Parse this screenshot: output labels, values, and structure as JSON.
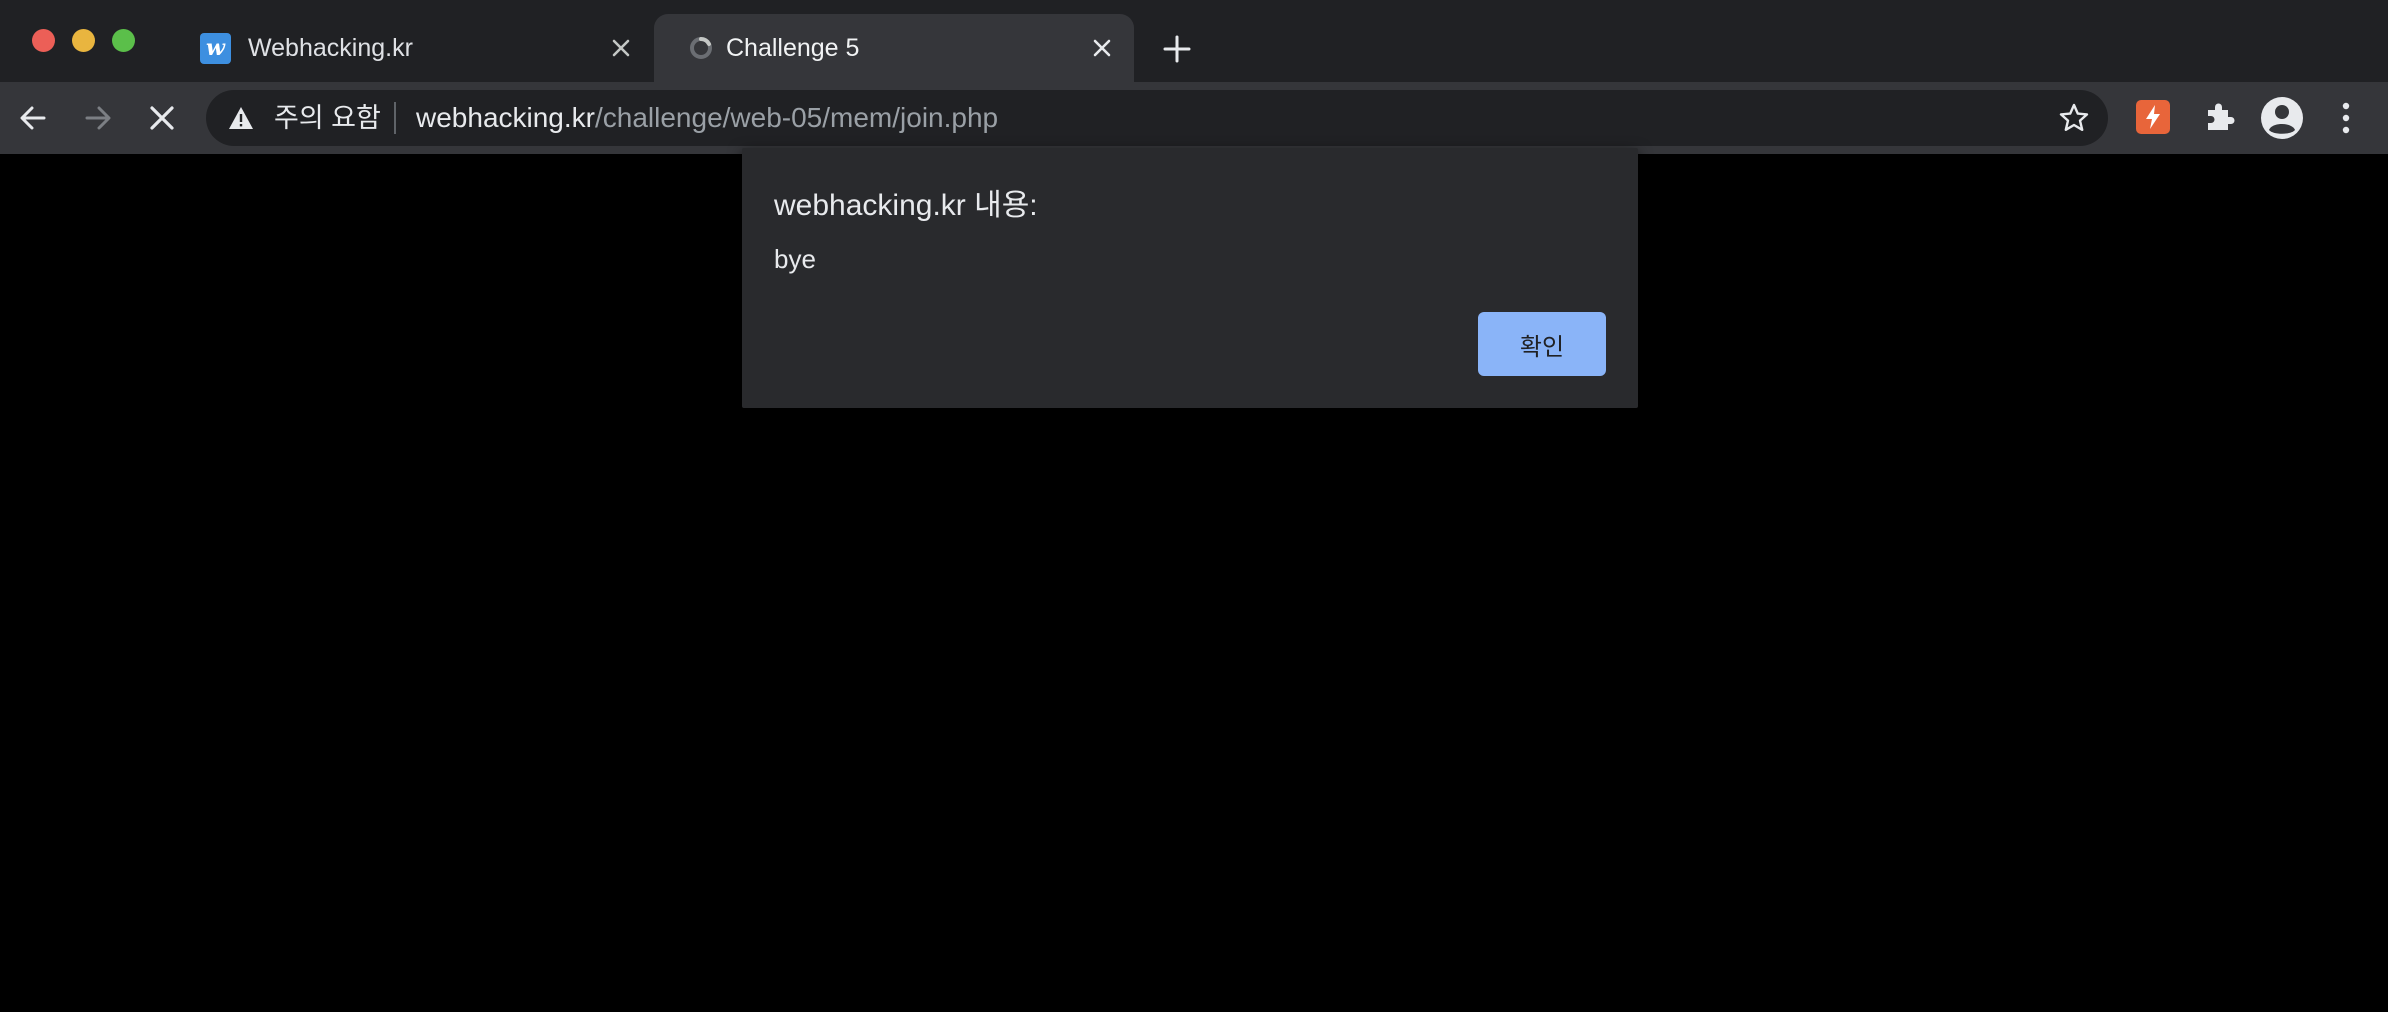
{
  "tabs": [
    {
      "title": "Webhacking.kr",
      "favicon": "w-logo-icon",
      "favicon_letter": "w",
      "active": false
    },
    {
      "title": "Challenge 5",
      "favicon": "loading-icon",
      "active": true
    }
  ],
  "toolbar": {
    "security_label": "주의 요함",
    "url_host": "webhacking.kr",
    "url_path": "/challenge/web-05/mem/join.php"
  },
  "dialog": {
    "title": "webhacking.kr 내용:",
    "message": "bye",
    "ok_label": "확인"
  },
  "colors": {
    "titlebar": "#202124",
    "toolbar": "#35363a",
    "dialog_bg": "#292a2d",
    "ok_button": "#8ab4f8",
    "extension_accent": "#e8653a",
    "page_bg": "#000000"
  }
}
